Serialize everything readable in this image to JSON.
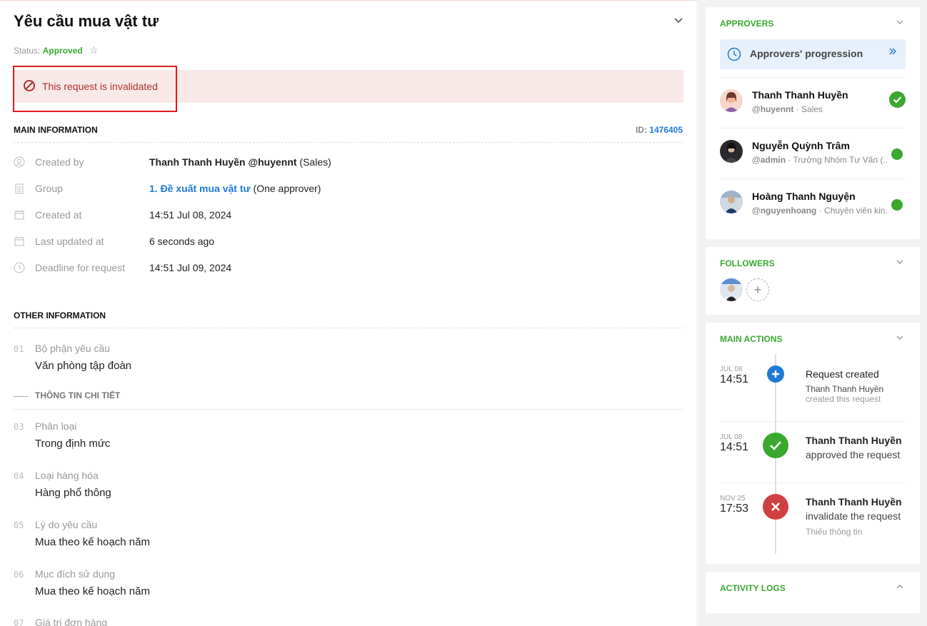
{
  "header": {
    "title": "Yêu cầu mua vật tư",
    "status_label": "Status:",
    "status_value": "Approved",
    "star_glyph": "☆",
    "collapse_glyph": "⌄"
  },
  "alert": {
    "text": "This request is invalidated"
  },
  "main_info": {
    "heading": "MAIN INFORMATION",
    "id_label": "ID:",
    "id_value": "1476405",
    "created_by": {
      "label": "Created by",
      "name": "Thanh Thanh Huyền @huyennt",
      "extra": " (Sales)"
    },
    "group": {
      "label": "Group",
      "link": "1. Đề xuất mua vật tư",
      "extra": " (One approver)"
    },
    "created_at": {
      "label": "Created at",
      "value": "14:51 Jul 08, 2024"
    },
    "last_updated": {
      "label": "Last updated at",
      "value": "6 seconds ago"
    },
    "deadline": {
      "label": "Deadline for request",
      "value": "14:51 Jul 09, 2024"
    }
  },
  "other_info": {
    "heading": "OTHER INFORMATION",
    "section_title": "THÔNG TIN CHI TIẾT",
    "fields": [
      {
        "num": "01",
        "label": "Bộ phận yêu cầu",
        "value": "Văn phòng tập đoàn"
      },
      {
        "num": "03",
        "label": "Phân loại",
        "value": "Trong định mức"
      },
      {
        "num": "04",
        "label": "Loại hàng hóa",
        "value": "Hàng phổ thông"
      },
      {
        "num": "05",
        "label": "Lý do yêu cầu",
        "value": "Mua theo kế hoạch năm"
      },
      {
        "num": "06",
        "label": "Mục đích sử dụng",
        "value": "Mua theo kế hoạch năm"
      },
      {
        "num": "07",
        "label": "Giá trị đơn hàng",
        "value": ""
      }
    ]
  },
  "approvers": {
    "heading": "APPROVERS",
    "progression_label": "Approvers' progression",
    "list": [
      {
        "name": "Thanh Thanh Huyền",
        "handle": "@huyennt",
        "role": " · Sales"
      },
      {
        "name": "Nguyễn Quỳnh Trâm",
        "handle": "@admin",
        "role": " · Trưởng Nhóm Tư Vấn (..."
      },
      {
        "name": "Hoàng Thanh Nguyện",
        "handle": "@nguyenhoang",
        "role": " · Chuyên viên kin..."
      }
    ]
  },
  "followers": {
    "heading": "FOLLOWERS",
    "add_glyph": "+"
  },
  "main_actions": {
    "heading": "MAIN ACTIONS",
    "events": [
      {
        "date": "JUL 08",
        "time": "14:51",
        "title": "Request created",
        "actor": "Thanh Thanh Huyền",
        "note": "created this request"
      },
      {
        "date": "JUL 08",
        "time": "14:51",
        "actor": "Thanh Thanh Huyền",
        "action": "approved the request"
      },
      {
        "date": "NOV 25",
        "time": "17:53",
        "actor": "Thanh Thanh Huyền",
        "action": "invalidate the request",
        "note": "Thiếu thông tin"
      }
    ]
  },
  "activity_logs": {
    "heading": "ACTIVITY LOGS"
  },
  "colors": {
    "green": "#3aa82e",
    "blue": "#1f7ad4",
    "red": "#d04040",
    "alert_bg": "#f8e8e7"
  }
}
